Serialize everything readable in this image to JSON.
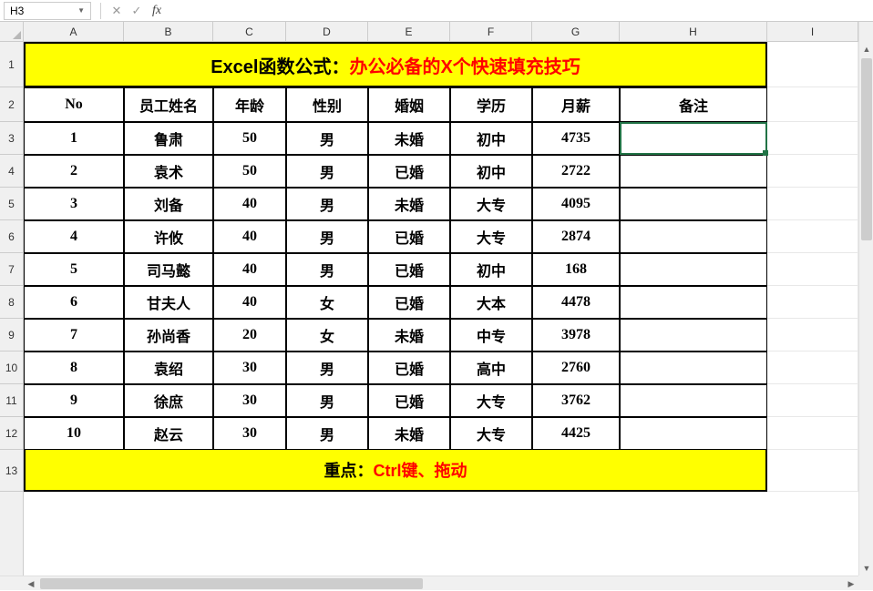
{
  "active_cell_ref": "H3",
  "formula_value": "",
  "columns": [
    "A",
    "B",
    "C",
    "D",
    "E",
    "F",
    "G",
    "H",
    "I"
  ],
  "row_numbers": [
    1,
    2,
    3,
    4,
    5,
    6,
    7,
    8,
    9,
    10,
    11,
    12,
    13
  ],
  "title_black": "Excel函数公式：",
  "title_red": "办公必备的X个快速填充技巧",
  "footer_black": "重点：",
  "footer_red": "Ctrl键、拖动",
  "headers": {
    "no": "No",
    "name": "员工姓名",
    "age": "年龄",
    "gender": "性别",
    "marital": "婚姻",
    "edu": "学历",
    "salary": "月薪",
    "remark": "备注"
  },
  "rows": [
    {
      "no": "1",
      "name": "鲁肃",
      "age": "50",
      "gender": "男",
      "marital": "未婚",
      "edu": "初中",
      "salary": "4735",
      "remark": ""
    },
    {
      "no": "2",
      "name": "袁术",
      "age": "50",
      "gender": "男",
      "marital": "已婚",
      "edu": "初中",
      "salary": "2722",
      "remark": ""
    },
    {
      "no": "3",
      "name": "刘备",
      "age": "40",
      "gender": "男",
      "marital": "未婚",
      "edu": "大专",
      "salary": "4095",
      "remark": ""
    },
    {
      "no": "4",
      "name": "许攸",
      "age": "40",
      "gender": "男",
      "marital": "已婚",
      "edu": "大专",
      "salary": "2874",
      "remark": ""
    },
    {
      "no": "5",
      "name": "司马懿",
      "age": "40",
      "gender": "男",
      "marital": "已婚",
      "edu": "初中",
      "salary": "168",
      "remark": ""
    },
    {
      "no": "6",
      "name": "甘夫人",
      "age": "40",
      "gender": "女",
      "marital": "已婚",
      "edu": "大本",
      "salary": "4478",
      "remark": ""
    },
    {
      "no": "7",
      "name": "孙尚香",
      "age": "20",
      "gender": "女",
      "marital": "未婚",
      "edu": "中专",
      "salary": "3978",
      "remark": ""
    },
    {
      "no": "8",
      "name": "袁绍",
      "age": "30",
      "gender": "男",
      "marital": "已婚",
      "edu": "高中",
      "salary": "2760",
      "remark": ""
    },
    {
      "no": "9",
      "name": "徐庶",
      "age": "30",
      "gender": "男",
      "marital": "已婚",
      "edu": "大专",
      "salary": "3762",
      "remark": ""
    },
    {
      "no": "10",
      "name": "赵云",
      "age": "30",
      "gender": "男",
      "marital": "未婚",
      "edu": "大专",
      "salary": "4425",
      "remark": ""
    }
  ]
}
